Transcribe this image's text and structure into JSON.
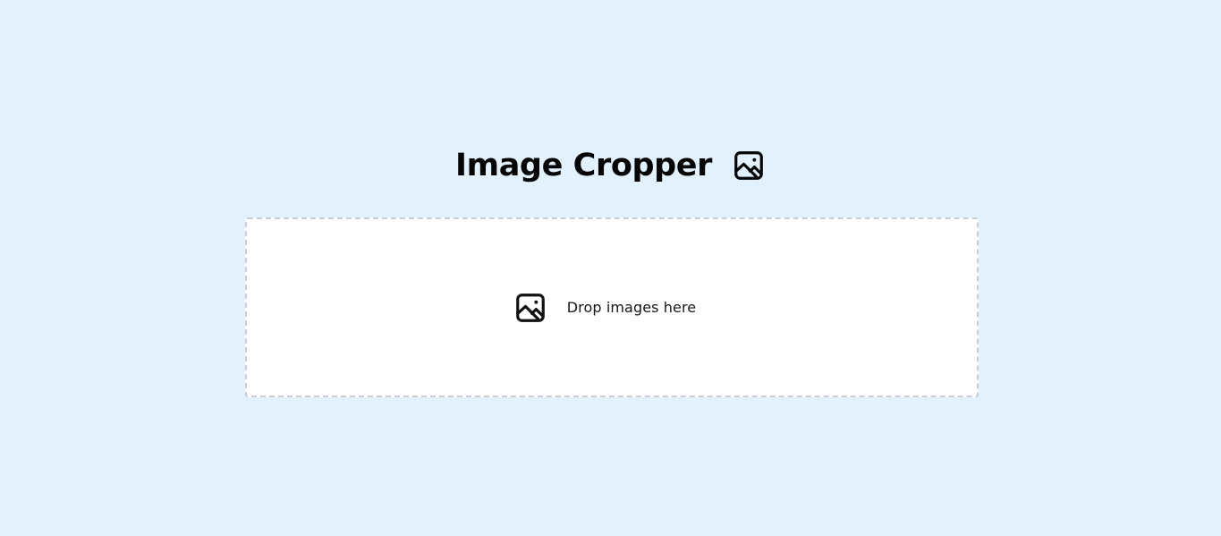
{
  "header": {
    "title": "Image Cropper",
    "icon": "image-icon"
  },
  "dropzone": {
    "label": "Drop images here",
    "icon": "image-icon"
  },
  "colors": {
    "background": "#e3f1fc",
    "panel": "#ffffff",
    "dashed_border": "#c7ced8",
    "text": "#050505"
  }
}
